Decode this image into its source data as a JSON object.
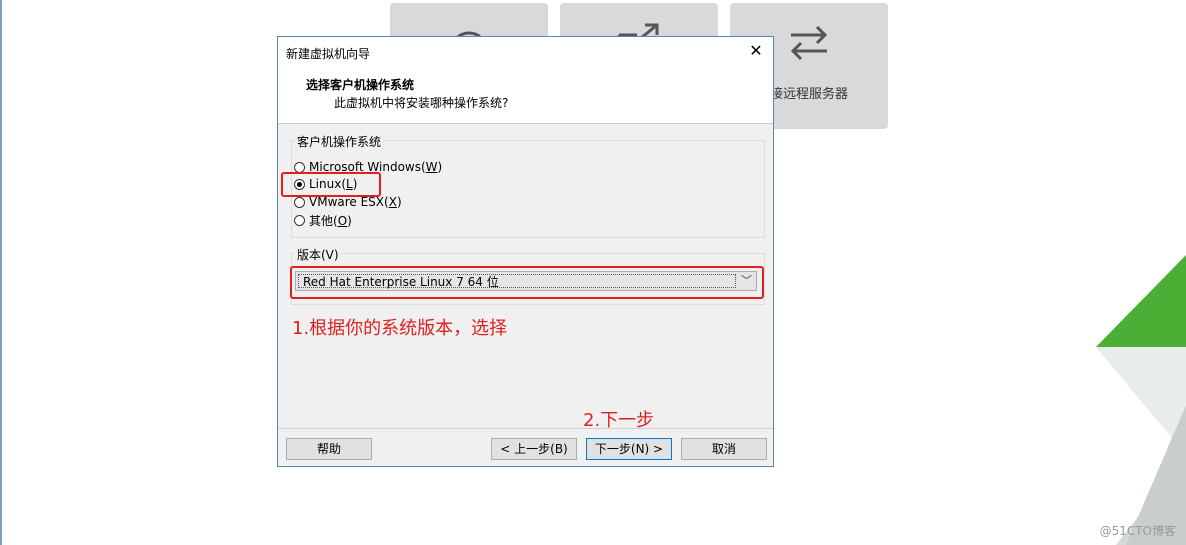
{
  "background": {
    "tile_3_label": "接远程服务器"
  },
  "dialog": {
    "title": "新建虚拟机向导",
    "header_title": "选择客户机操作系统",
    "header_subtitle": "此虚拟机中将安装哪种操作系统?",
    "os_group_label": "客户机操作系统",
    "os_options": [
      {
        "label": "Microsoft Windows(",
        "key": "W",
        "suffix": ")",
        "checked": false
      },
      {
        "label": "Linux(",
        "key": "L",
        "suffix": ")",
        "checked": true
      },
      {
        "label": "VMware ESX(",
        "key": "X",
        "suffix": ")",
        "checked": false
      },
      {
        "label": "其他(",
        "key": "O",
        "suffix": ")",
        "checked": false
      }
    ],
    "version_group_label": "版本(V)",
    "version_selected": "Red Hat Enterprise Linux 7 64 位",
    "buttons": {
      "help": "帮助",
      "back": "< 上一步(B)",
      "next": "下一步(N) >",
      "cancel": "取消"
    }
  },
  "annotations": {
    "step1": "1.根据你的系统版本，选择",
    "step2": "2.下一步"
  },
  "watermark": "@51CTO博客",
  "colors": {
    "annotation_red": "#e02020",
    "accent_green": "#4caf35",
    "dialog_border": "#5b86b3"
  }
}
